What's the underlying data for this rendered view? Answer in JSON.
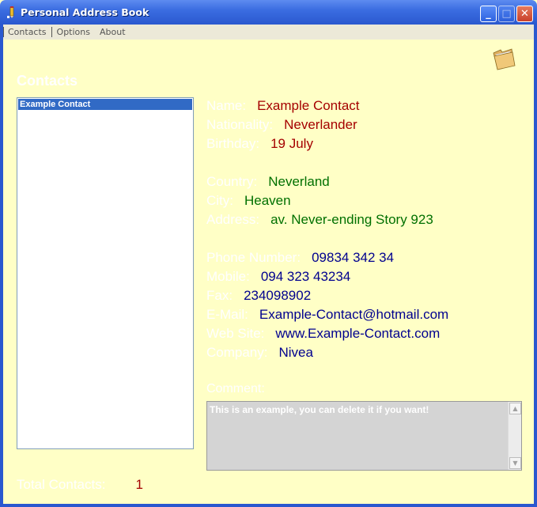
{
  "window": {
    "title": "Personal Address Book",
    "minimize": "_",
    "maximize": "□",
    "close": "✕"
  },
  "menu": [
    "Contacts",
    "Options",
    "About"
  ],
  "section_title": "Contacts",
  "contacts": [
    "Example Contact"
  ],
  "details": {
    "name": {
      "label": "Name:",
      "value": "Example Contact"
    },
    "nationality": {
      "label": "Nationality:",
      "value": "Neverlander"
    },
    "birthday": {
      "label": "Birthday:",
      "value": "19 July"
    },
    "country": {
      "label": "Country:",
      "value": "Neverland"
    },
    "city": {
      "label": "City:",
      "value": "Heaven"
    },
    "address": {
      "label": "Address:",
      "value": "av. Never-ending Story 923"
    },
    "phone": {
      "label": "Phone Number:",
      "value": "09834 342 34"
    },
    "mobile": {
      "label": "Mobile:",
      "value": "094 323 43234"
    },
    "fax": {
      "label": "Fax:",
      "value": "234098902"
    },
    "email": {
      "label": "E-Mail:",
      "value": "Example-Contact@hotmail.com"
    },
    "website": {
      "label": "Web Site:",
      "value": "www.Example-Contact.com"
    },
    "company": {
      "label": "Company:",
      "value": "Nivea"
    }
  },
  "comment": {
    "label": "Comment:",
    "text": "This is an example, you can delete it if you want!"
  },
  "total": {
    "label": "Total Contacts:",
    "value": "1"
  },
  "icons": {
    "app": "pencil-icon",
    "folder": "folder-icon"
  },
  "colors": {
    "background": "#ffffc6",
    "title_bar": "#2a58cf",
    "personal_value": "#a50000",
    "location_value": "#007000",
    "contact_value": "#00008f",
    "selection": "#316ac5"
  }
}
